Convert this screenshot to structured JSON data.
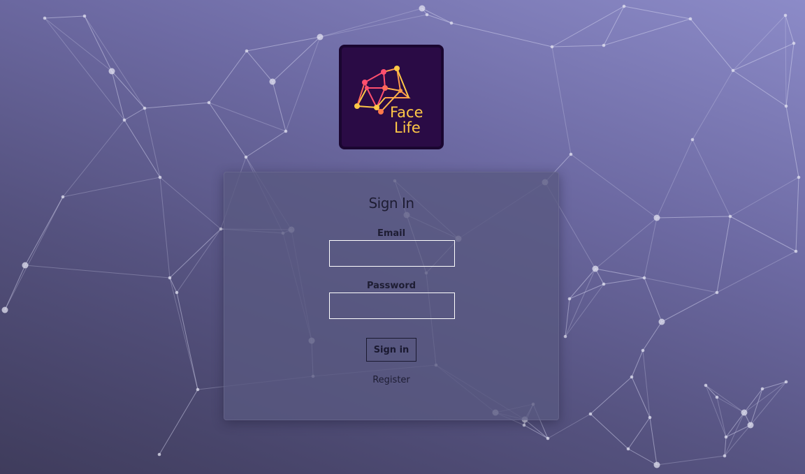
{
  "logo": {
    "line1": "Face",
    "line2": "Life"
  },
  "form": {
    "title": "Sign In",
    "email_label": "Email",
    "email_value": "",
    "password_label": "Password",
    "password_value": "",
    "signin_label": "Sign in",
    "register_label": "Register"
  },
  "colors": {
    "background_top": "#8c8bc8",
    "background_bottom": "#3f3c5c",
    "logo_background": "#2a0b45",
    "logo_accent_pink": "#ff4f6e",
    "logo_accent_orange": "#ff9a4a",
    "logo_accent_yellow": "#ffc846"
  }
}
